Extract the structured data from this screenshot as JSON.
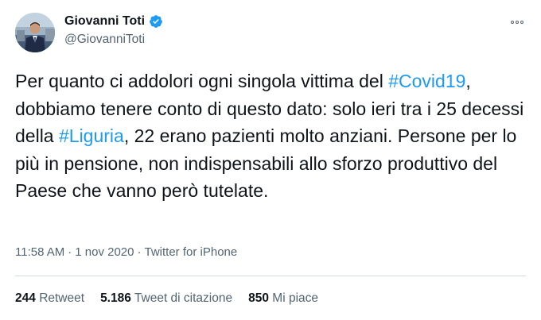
{
  "author": {
    "display_name": "Giovanni Toti",
    "handle": "@GiovanniToti",
    "verified": true
  },
  "tweet": {
    "segments": [
      {
        "text": "Per quanto ci addolori ogni singola vittima del ",
        "type": "text"
      },
      {
        "text": "#Covid19",
        "type": "hashtag"
      },
      {
        "text": ", dobbiamo tenere conto di questo dato: solo ieri tra i 25 decessi della ",
        "type": "text"
      },
      {
        "text": "#Liguria",
        "type": "hashtag"
      },
      {
        "text": ", 22 erano pazienti molto anziani. Persone per lo più in pensione, non indispensabili allo sforzo produttivo del Paese che vanno però tutelate.",
        "type": "text"
      }
    ]
  },
  "meta": {
    "time": "11:58 AM",
    "separator": "·",
    "date": "1 nov 2020",
    "source": "Twitter for iPhone"
  },
  "stats": {
    "retweets_count": "244",
    "retweets_label": "Retweet",
    "quotes_count": "5.186",
    "quotes_label": "Tweet di citazione",
    "likes_count": "850",
    "likes_label": "Mi piace"
  },
  "colors": {
    "accent": "#1d9bf0",
    "text": "#0f1419",
    "secondary": "#536471",
    "divider": "#cfd9de"
  },
  "icons": {
    "verified": "verified-badge-icon",
    "more": "more-options-icon"
  }
}
